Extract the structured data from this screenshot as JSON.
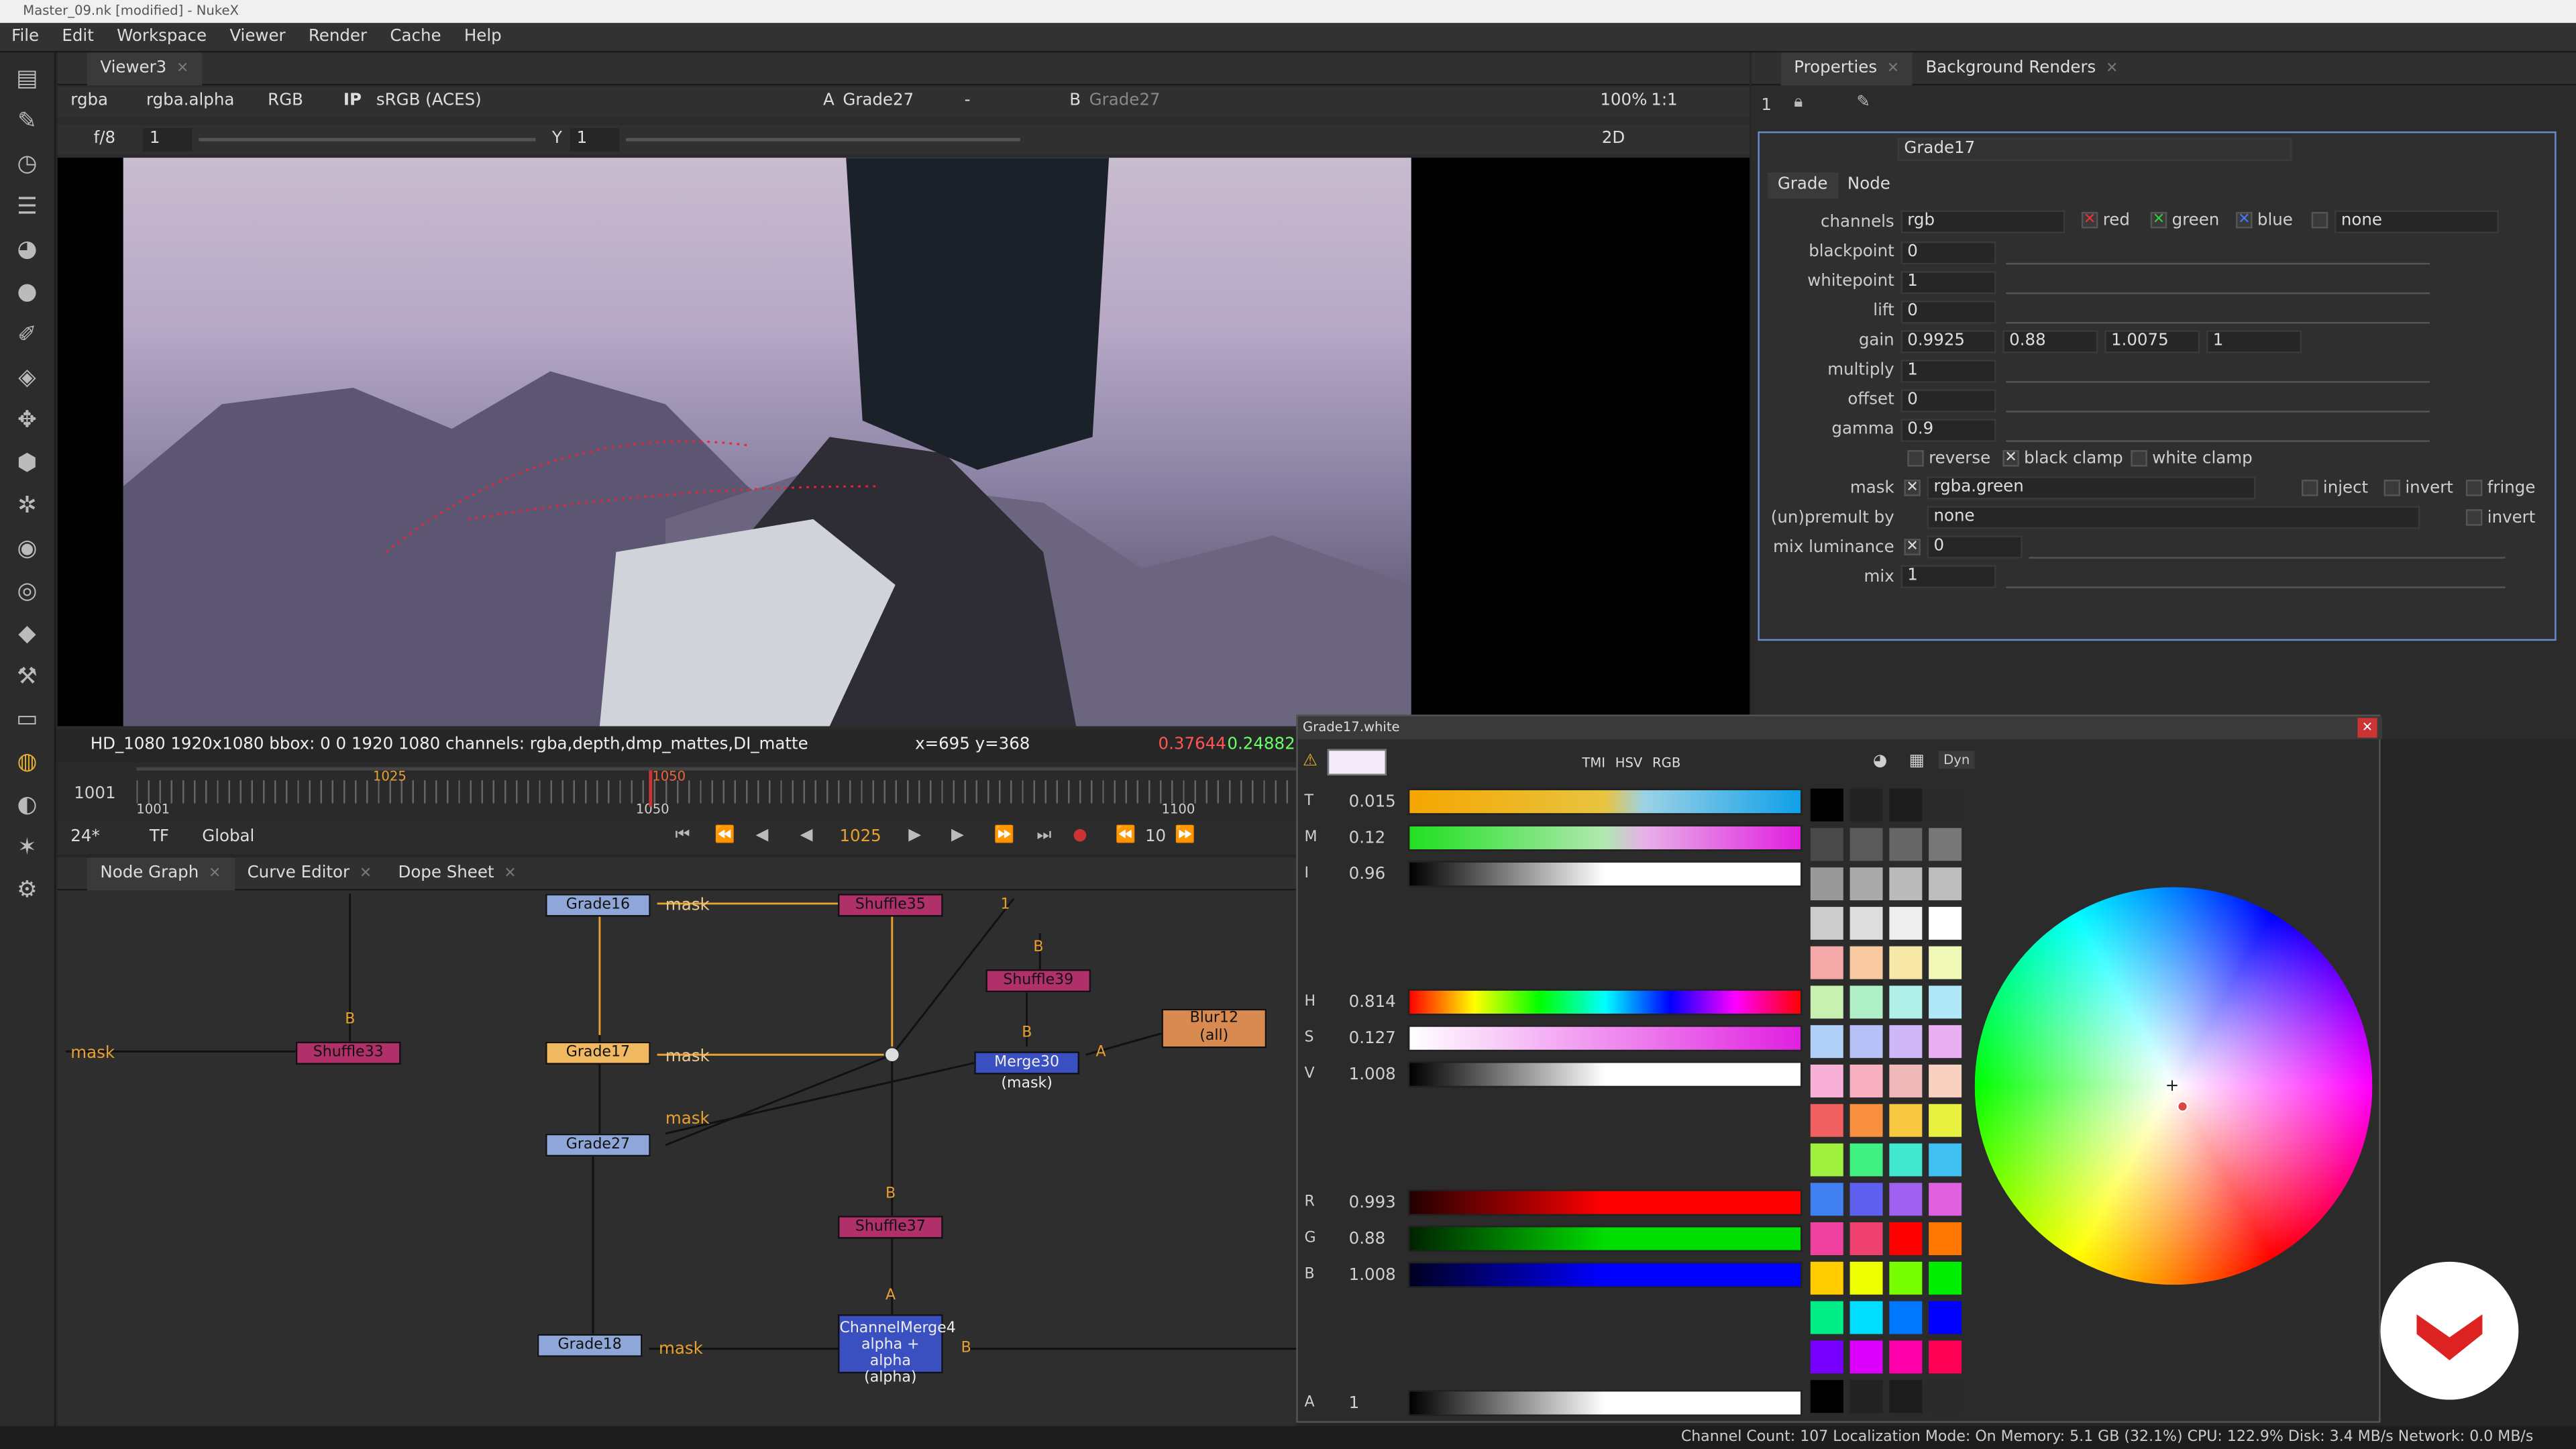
{
  "window": {
    "title": "Master_09.nk [modified] - NukeX"
  },
  "menu": [
    "File",
    "Edit",
    "Workspace",
    "Viewer",
    "Render",
    "Cache",
    "Help"
  ],
  "viewer": {
    "tab": "Viewer3",
    "channel_set": "rgba",
    "channel_alpha": "rgba.alpha",
    "display_channels": "RGB",
    "ip": "IP",
    "colorspace": "sRGB (ACES)",
    "input_a_label": "A",
    "input_a": "Grade27",
    "input_mid": "-",
    "input_b_label": "B",
    "input_b": "Grade27",
    "zoom": "100%",
    "ratio": "1:1",
    "fstop": "f/8",
    "gain_val": "1",
    "y_label": "Y",
    "gamma_val": "1",
    "mode": "2D",
    "status_format": "HD_1080 1920x1080  bbox: 0 0 1920 1080 channels: rgba,depth,dmp_mattes,DI_matte",
    "coords": "x=695 y=368",
    "pixel_r": "0.37644",
    "pixel_g": "0.24882"
  },
  "timeline": {
    "start": "1001",
    "tick_1001": "1001",
    "tick_1050": "1050",
    "tick_1100": "1100",
    "current_marker": "1025",
    "end_marker": "1050",
    "fps": "24*",
    "tf": "TF",
    "scope": "Global",
    "current_frame": "1025",
    "step": "10"
  },
  "nodegraph": {
    "tabs": [
      "Node Graph",
      "Curve Editor",
      "Dope Sheet"
    ],
    "nodes": {
      "grade16": "Grade16",
      "shuffle35": "Shuffle35",
      "shuffle39": "Shuffle39",
      "blur12_a": "Blur12",
      "blur12_b": "(all)",
      "shuffle33": "Shuffle33",
      "grade17": "Grade17",
      "merge30": "Merge30 (mask)",
      "grade27": "Grade27",
      "shuffle37": "Shuffle37",
      "grade18": "Grade18",
      "cm_a": "ChannelMerge4",
      "cm_b": "alpha + alpha",
      "cm_c": "(alpha)"
    },
    "labels": {
      "mask1": "mask",
      "mask2": "mask",
      "mask3": "mask",
      "mask4": "mask",
      "mask5": "mask",
      "b1": "B",
      "b2": "B",
      "b3": "B",
      "b4": "B",
      "b5": "B",
      "a1": "A",
      "a2": "A",
      "one": "1"
    }
  },
  "properties": {
    "tabs": [
      "Properties",
      "Background Renders"
    ],
    "count": "1",
    "node_name": "Grade17",
    "subtabs": [
      "Grade",
      "Node"
    ],
    "channels_label": "channels",
    "channels": "rgb",
    "red": "red",
    "green": "green",
    "blue": "blue",
    "none": "none",
    "rows": [
      {
        "label": "blackpoint",
        "value": "0"
      },
      {
        "label": "whitepoint",
        "value": "1"
      },
      {
        "label": "lift",
        "value": "0"
      },
      {
        "label": "gain",
        "value": "0.9925",
        "v2": "0.88",
        "v3": "1.0075",
        "v4": "1"
      },
      {
        "label": "multiply",
        "value": "1"
      },
      {
        "label": "offset",
        "value": "0"
      },
      {
        "label": "gamma",
        "value": "0.9"
      }
    ],
    "reverse": "reverse",
    "black_clamp": "black clamp",
    "white_clamp": "white clamp",
    "mask_label": "mask",
    "mask_value": "rgba.green",
    "inject": "inject",
    "invert": "invert",
    "fringe": "fringe",
    "premult_label": "(un)premult by",
    "premult_value": "none",
    "invert2": "invert",
    "mixlum_label": "mix luminance",
    "mixlum_value": "0",
    "mix_label": "mix",
    "mix_value": "1"
  },
  "colorpicker": {
    "title": "Grade17.white",
    "modes": [
      "TMI",
      "HSV",
      "RGB"
    ],
    "dyn": "Dyn",
    "sliders": [
      {
        "key": "T",
        "value": "0.015"
      },
      {
        "key": "M",
        "value": "0.12"
      },
      {
        "key": "I",
        "value": "0.96"
      },
      {
        "key": "H",
        "value": "0.814"
      },
      {
        "key": "S",
        "value": "0.127"
      },
      {
        "key": "V",
        "value": "1.008"
      },
      {
        "key": "R",
        "value": "0.993"
      },
      {
        "key": "G",
        "value": "0.88"
      },
      {
        "key": "B",
        "value": "1.008"
      },
      {
        "key": "A",
        "value": "1"
      }
    ]
  },
  "statusbar": "Channel Count: 107  Localization Mode: On  Memory: 5.1 GB (32.1%)  CPU: 122.9%  Disk: 3.4 MB/s  Network: 0.0 MB/s"
}
